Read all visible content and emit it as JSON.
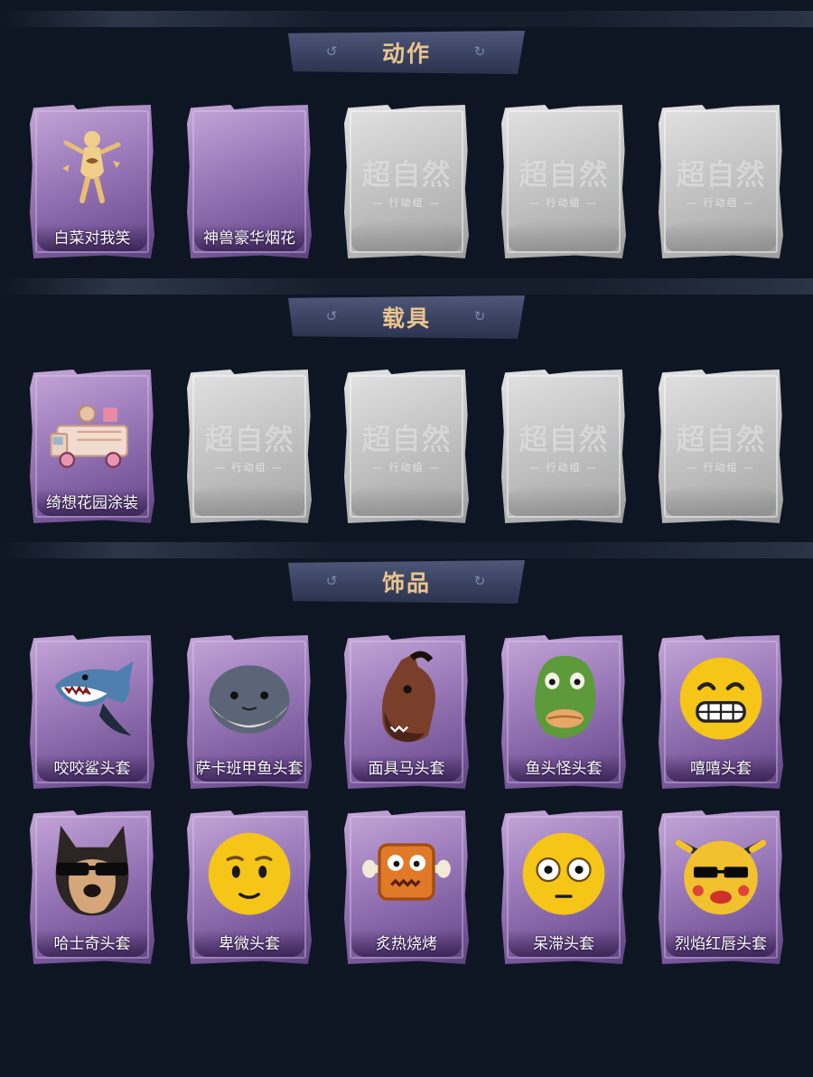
{
  "sections": [
    {
      "title": "动作",
      "items": [
        {
          "label": "白菜对我笑",
          "icon": "dancing-figure-icon",
          "locked": false
        },
        {
          "label": "神兽豪华烟花",
          "icon": "fireworks-icon",
          "locked": false
        },
        {
          "label": "",
          "icon": "locked-card-icon",
          "locked": true
        },
        {
          "label": "",
          "icon": "locked-card-icon",
          "locked": true
        },
        {
          "label": "",
          "icon": "locked-card-icon",
          "locked": true
        }
      ]
    },
    {
      "title": "载具",
      "items": [
        {
          "label": "绮想花园涂装",
          "icon": "decorated-truck-icon",
          "locked": false
        },
        {
          "label": "",
          "icon": "locked-card-icon",
          "locked": true
        },
        {
          "label": "",
          "icon": "locked-card-icon",
          "locked": true
        },
        {
          "label": "",
          "icon": "locked-card-icon",
          "locked": true
        },
        {
          "label": "",
          "icon": "locked-card-icon",
          "locked": true
        }
      ]
    },
    {
      "title": "饰品",
      "items": [
        {
          "label": "咬咬鲨头套",
          "icon": "shark-head-icon",
          "locked": false
        },
        {
          "label": "萨卡班甲鱼头套",
          "icon": "fish-head-icon",
          "locked": false
        },
        {
          "label": "面具马头套",
          "icon": "horse-head-icon",
          "locked": false
        },
        {
          "label": "鱼头怪头套",
          "icon": "green-fish-head-icon",
          "locked": false
        },
        {
          "label": "嘻嘻头套",
          "icon": "grinning-emoji-icon",
          "locked": false
        },
        {
          "label": "哈士奇头套",
          "icon": "husky-head-icon",
          "locked": false
        },
        {
          "label": "卑微头套",
          "icon": "humble-emoji-icon",
          "locked": false
        },
        {
          "label": "炙热烧烤",
          "icon": "grilled-meat-icon",
          "locked": false
        },
        {
          "label": "呆滞头套",
          "icon": "dazed-emoji-icon",
          "locked": false
        },
        {
          "label": "烈焰红唇头套",
          "icon": "red-lips-emoji-icon",
          "locked": false
        }
      ]
    }
  ],
  "locked_watermark": {
    "main": "超自然",
    "sub": "— 行动组 —"
  },
  "colors": {
    "background": "#0f1623",
    "banner": "#3a4262",
    "banner_text": "#e9c58e",
    "card_purple": "#9f7ebd",
    "card_locked": "#c9c9c9"
  }
}
